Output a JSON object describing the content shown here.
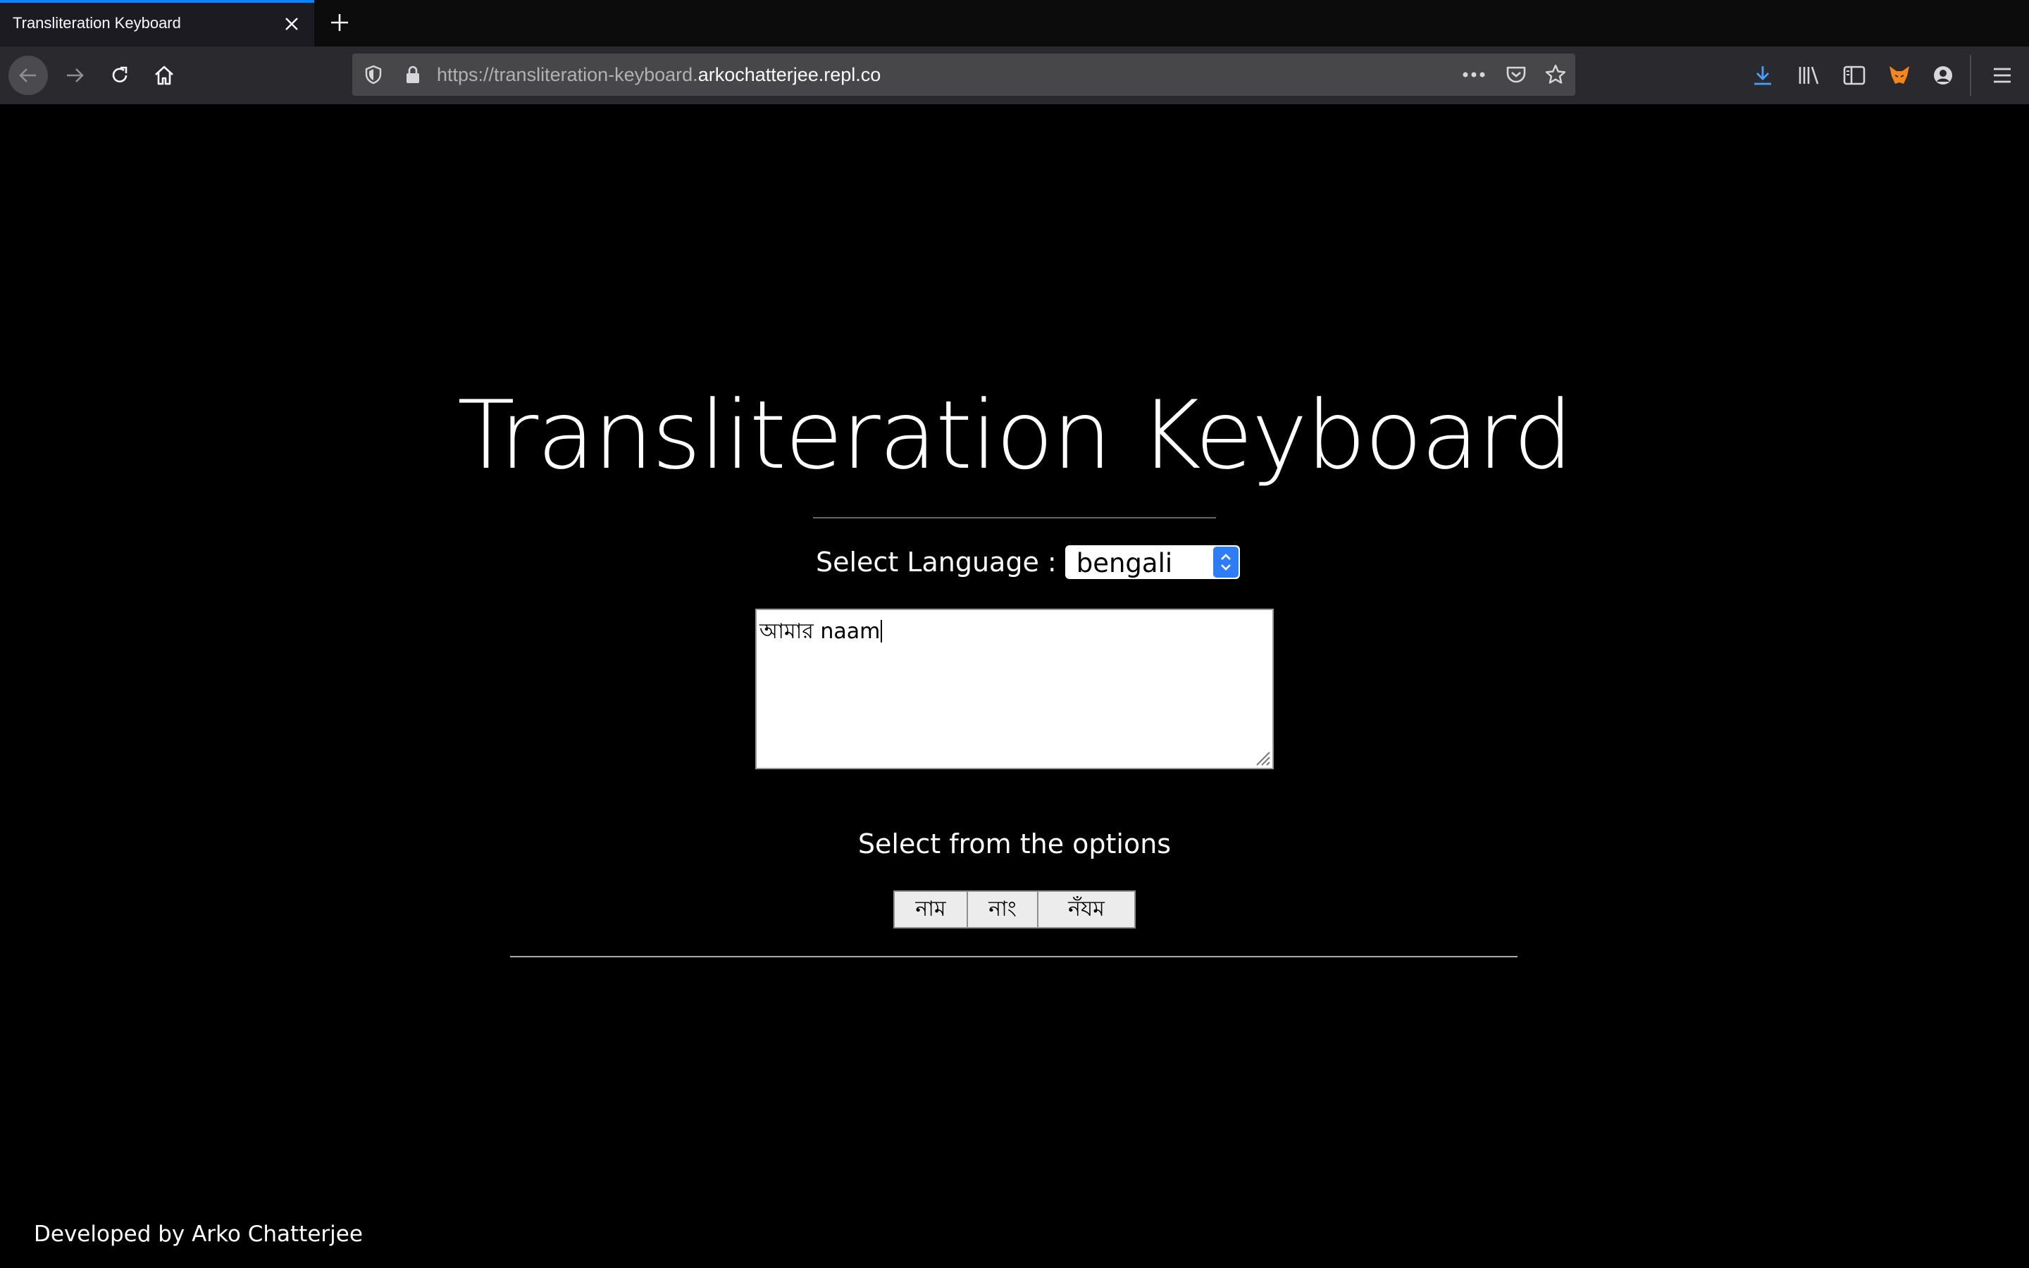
{
  "browser": {
    "tab_title": "Transliteration Keyboard",
    "url_prefix": "https://transliteration-keyboard.",
    "url_domain": "arkochatterjee.repl.co",
    "accent_color": "#0a84ff"
  },
  "page": {
    "title": "Transliteration Keyboard",
    "language_label": "Select Language :",
    "language_selected": "bengali",
    "textarea_value": "আমার naam",
    "options_label": "Select from the options",
    "options": [
      "নাম",
      "নাং",
      "নঁযম"
    ],
    "footer": "Developed by Arko Chatterjee"
  }
}
